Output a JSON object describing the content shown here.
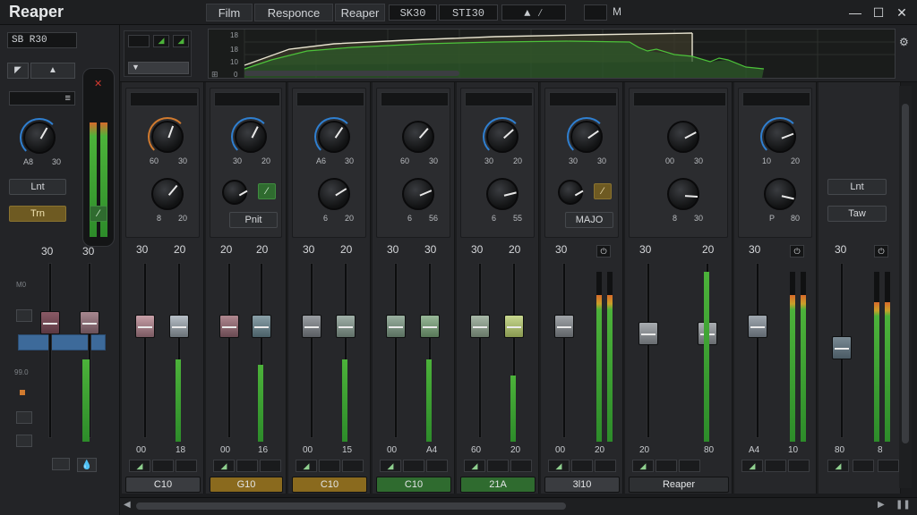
{
  "app": {
    "title": "Reaper"
  },
  "titlebar": {
    "tabs": [
      "Film",
      "Responce",
      "Reaper"
    ],
    "boxes": [
      "SK30",
      "STI30"
    ],
    "menu_m": "M"
  },
  "left": {
    "display": "SB R30",
    "knob_labels": [
      "A8",
      "30"
    ],
    "btn1": "Lnt",
    "btn2": "Trn",
    "top_vals": [
      "30",
      "30"
    ],
    "scale": [
      "M0",
      "99.0"
    ],
    "bottom_btn": "▲"
  },
  "wave": {
    "scale": [
      "18",
      "18",
      "10",
      "0"
    ]
  },
  "channels": [
    {
      "k1": [
        "60",
        "30"
      ],
      "k2": [
        "8",
        "20"
      ],
      "vals": [
        "30",
        "20"
      ],
      "bottom": [
        "00",
        "18"
      ],
      "name": "C10",
      "name_color": "#3a3c40"
    },
    {
      "k1": [
        "30",
        "20"
      ],
      "k2": [],
      "btn": "Pnit",
      "vals": [
        "20",
        "20"
      ],
      "bottom": [
        "00",
        "16"
      ],
      "name": "G10",
      "name_color": "#8a6a1e"
    },
    {
      "k1": [
        "A6",
        "30"
      ],
      "k2": [
        "6",
        "20"
      ],
      "vals": [
        "30",
        "20"
      ],
      "bottom": [
        "00",
        "15"
      ],
      "name": "C10",
      "name_color": "#8a6a1e"
    },
    {
      "k1": [
        "60",
        "30"
      ],
      "k2": [
        "6",
        "56"
      ],
      "vals": [
        "30",
        "30"
      ],
      "bottom": [
        "00",
        "A4"
      ],
      "name": "C10",
      "name_color": "#2f6b2f"
    },
    {
      "k1": [
        "30",
        "20"
      ],
      "k2": [
        "6",
        "55"
      ],
      "vals": [
        "30",
        "20"
      ],
      "bottom": [
        "60",
        "20"
      ],
      "name": "21A",
      "name_color": "#2f6b2f"
    },
    {
      "k1": [
        "30",
        "30"
      ],
      "k2": [],
      "btn": "MAJO",
      "vals": [
        "30",
        ""
      ],
      "bottom": [
        "00",
        "20"
      ],
      "name": "3l10",
      "name_color": "#3a3c40"
    },
    {
      "k1": [
        "00",
        "30"
      ],
      "k2": [
        "8",
        "30"
      ],
      "vals": [
        "30",
        "20"
      ],
      "bottom": [
        "20",
        "80"
      ],
      "name": "Reaper",
      "name_color": "#2e3033"
    },
    {
      "k1": [
        "10",
        "20"
      ],
      "k2": [
        "P",
        "80"
      ],
      "vals": [
        "30",
        ""
      ],
      "bottom": [
        "A4",
        "10"
      ],
      "name": "",
      "name_color": ""
    }
  ],
  "right": {
    "btn1": "Lnt",
    "btn2": "Taw",
    "vals": [
      "30",
      ""
    ],
    "bottom": [
      "80",
      "8"
    ]
  }
}
